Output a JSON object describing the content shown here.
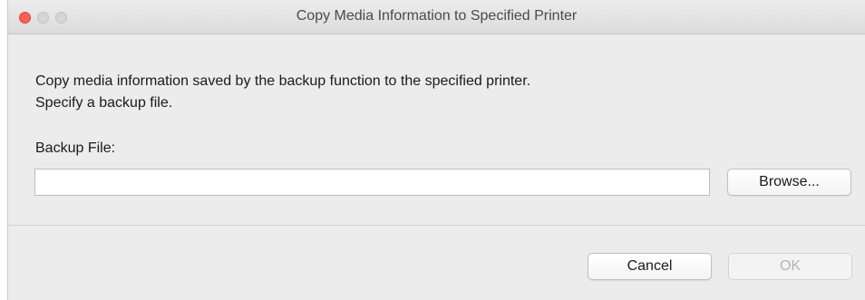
{
  "window": {
    "title": "Copy Media Information to Specified Printer"
  },
  "dialog": {
    "description_line1": "Copy media information saved by the backup function to the specified printer.",
    "description_line2": "Specify a backup file.",
    "backup_file_label": "Backup File:",
    "backup_file_value": "",
    "browse_label": "Browse...",
    "cancel_label": "Cancel",
    "ok_label": "OK",
    "ok_enabled": false
  },
  "colors": {
    "close_button": "#fc5d57",
    "inactive_traffic": "#d5d5d5",
    "window_bg": "#ececec",
    "disabled_text": "#b4b4b4"
  }
}
